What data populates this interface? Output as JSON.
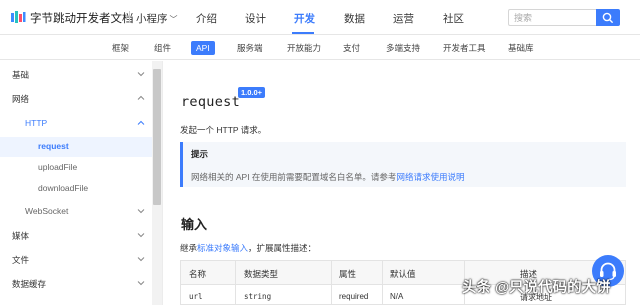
{
  "brand": {
    "name": "字节跳动开发者文档",
    "product": "小程序"
  },
  "nav": [
    {
      "label": "介绍",
      "active": false
    },
    {
      "label": "设计",
      "active": false
    },
    {
      "label": "开发",
      "active": true
    },
    {
      "label": "数据",
      "active": false
    },
    {
      "label": "运营",
      "active": false
    },
    {
      "label": "社区",
      "active": false
    }
  ],
  "search": {
    "placeholder": "搜索"
  },
  "subnav": [
    {
      "label": "框架",
      "active": false
    },
    {
      "label": "组件",
      "active": false
    },
    {
      "label": "API",
      "active": true
    },
    {
      "label": "服务端",
      "active": false
    },
    {
      "label": "开放能力",
      "active": false
    },
    {
      "label": "支付",
      "active": false
    },
    {
      "label": "多端支持",
      "active": false
    },
    {
      "label": "开发者工具",
      "active": false
    },
    {
      "label": "基础库",
      "active": false
    }
  ],
  "sidebar": {
    "items": [
      {
        "label": "基础",
        "chevron": "down"
      },
      {
        "label": "网络",
        "chevron": "up"
      },
      {
        "label": "HTTP",
        "chevron": "up"
      },
      {
        "label": "request",
        "chevron": ""
      },
      {
        "label": "uploadFile",
        "chevron": ""
      },
      {
        "label": "downloadFile",
        "chevron": ""
      },
      {
        "label": "WebSocket",
        "chevron": "down"
      },
      {
        "label": "媒体",
        "chevron": "down"
      },
      {
        "label": "文件",
        "chevron": "down"
      },
      {
        "label": "数据缓存",
        "chevron": "down"
      }
    ]
  },
  "content": {
    "title": "request",
    "version": "1.0.0+",
    "description": "发起一个 HTTP 请求。",
    "tip": {
      "title": "提示",
      "text_before": "网络相关的 API 在使用前需要配置域名白名单。请参考",
      "link": "网络请求使用说明"
    },
    "input_heading": "输入",
    "inherit_before": "继承",
    "inherit_link": "标准对象输入",
    "inherit_after": "，扩展属性描述：",
    "table": {
      "headers": [
        "名称",
        "数据类型",
        "属性",
        "默认值",
        "描述"
      ],
      "row": [
        "url",
        "string",
        "required",
        "N/A",
        "请求地址"
      ]
    }
  },
  "watermark": "头条 @只说代码的大饼",
  "colors": {
    "accent": "#3c7cfc",
    "help_button": "#3c7cfc"
  },
  "icons": {
    "logo": "bytedance-logo-icon",
    "search": "search-icon",
    "help": "headset-icon"
  }
}
